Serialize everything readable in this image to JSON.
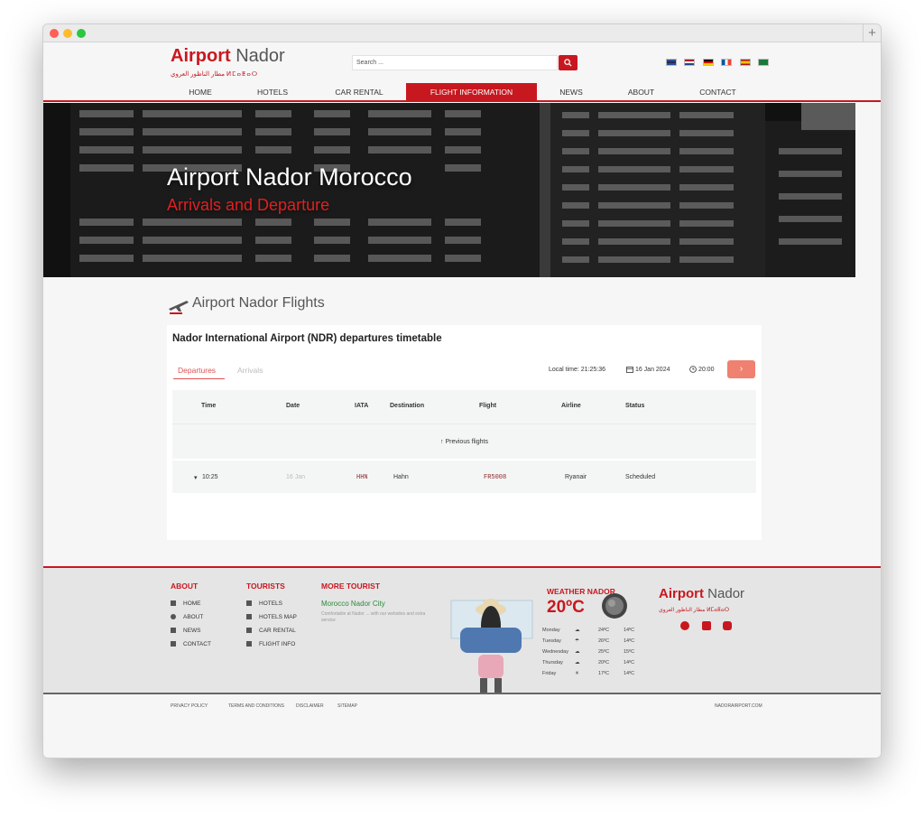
{
  "header": {
    "logo_primary": "Airport",
    "logo_secondary": "Nador",
    "logo_arabic": "مطار الناظور العروي ⵍⵎⴰⵟⴰⵔ",
    "search_placeholder": "Search ...",
    "flags": [
      "uk-flag",
      "nl-flag",
      "de-flag",
      "fr-flag",
      "es-flag",
      "sa-flag"
    ],
    "nav": [
      "HOME",
      "HOTELS",
      "CAR RENTAL",
      "FLIGHT INFORMATION",
      "NEWS",
      "ABOUT",
      "CONTACT"
    ]
  },
  "hero": {
    "title": "Airport Nador Morocco",
    "subtitle": "Arrivals and Departure"
  },
  "flights": {
    "section_title": "Airport Nador Flights",
    "card_title": "Nador International Airport (NDR) departures timetable",
    "tabs": [
      "Departures",
      "Arrivals"
    ],
    "local_time": "Local time: 21:25:36",
    "date": "16 Jan 2024",
    "time": "20:00",
    "columns": [
      "Time",
      "Date",
      "IATA",
      "Destination",
      "Flight",
      "Airline",
      "Status"
    ],
    "previous": "Previous flights",
    "rows": [
      {
        "time": "10:25",
        "date": "16 Jan",
        "iata": "HHN",
        "destination": "Hahn",
        "flight": "FR5008",
        "airline": "Ryanair",
        "status": "Scheduled"
      }
    ]
  },
  "footer": {
    "about_title": "ABOUT",
    "about_links": [
      "HOME",
      "ABOUT",
      "NEWS",
      "CONTACT"
    ],
    "tourists_title": "TOURISTS",
    "tourists_links": [
      "HOTELS",
      "HOTELS MAP",
      "CAR RENTAL",
      "FLIGHT INFO"
    ],
    "more_title": "MORE TOURIST",
    "more_link": "Morocco Nador City",
    "more_text": "Comfortable at Nador ... with our websites and extra service",
    "weather_title": "WEATHER NADOR",
    "weather_temp": "20ºC",
    "weather_days": [
      {
        "day": "Monday",
        "high": "24ºC",
        "low": "14ºC"
      },
      {
        "day": "Tuesday",
        "high": "26ºC",
        "low": "14ºC"
      },
      {
        "day": "Wednesday",
        "high": "25ºC",
        "low": "15ºC"
      },
      {
        "day": "Thursday",
        "high": "20ºC",
        "low": "14ºC"
      },
      {
        "day": "Friday",
        "high": "17ºC",
        "low": "14ºC"
      }
    ],
    "logo_primary": "Airport",
    "logo_secondary": "Nador",
    "logo_arabic": "مطار الناظور العروي ⵍⵎⴰⵟⴰⵔ",
    "bottom_links": [
      "PRIVACY POLICY",
      "TERMS AND CONDITIONS",
      "DISCLAIMER",
      "SITEMAP"
    ],
    "domain": "NADORAIRPORT.COM"
  },
  "colors": {
    "brand": "#c8181f",
    "accent": "#f08070"
  }
}
